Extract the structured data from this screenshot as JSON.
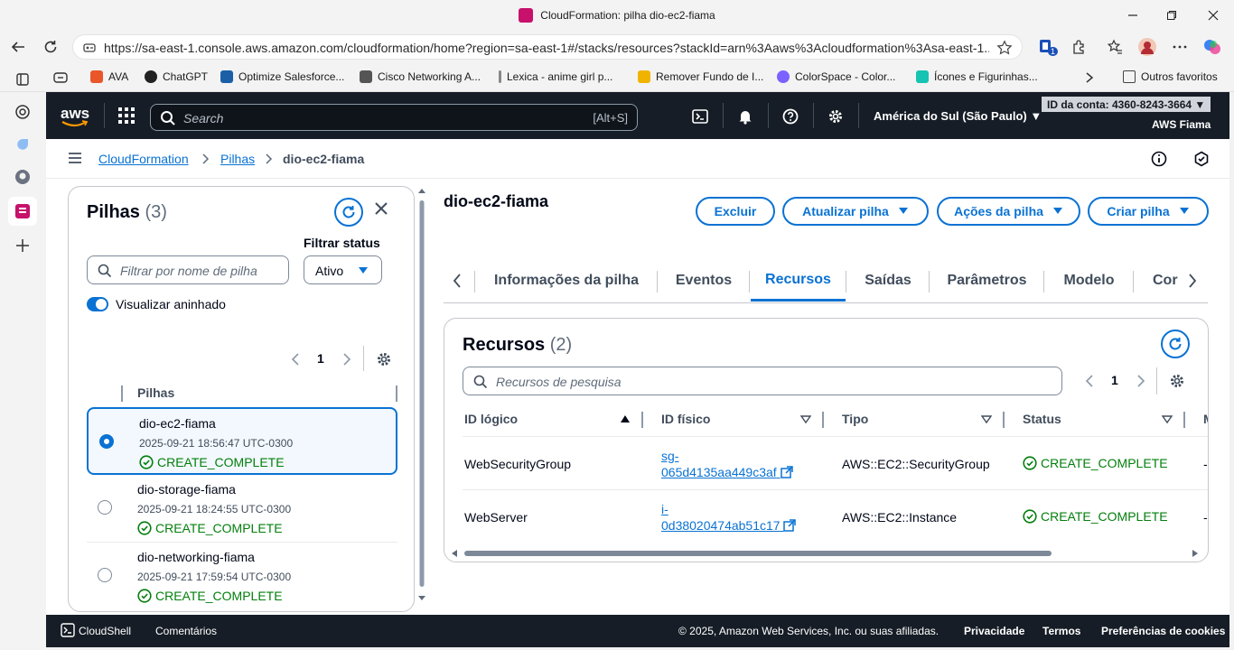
{
  "browser": {
    "tab_title": "CloudFormation: pilha dio-ec2-fiama",
    "url": "https://sa-east-1.console.aws.amazon.com/cloudformation/home?region=sa-east-1#/stacks/resources?stackId=arn%3Aaws%3Acloudformation%3Asa-east-1...",
    "extension_badge": "1",
    "bookmarks": [
      {
        "label": "AVA",
        "icon": "ava-icon",
        "color": "#e8562a"
      },
      {
        "label": "ChatGPT",
        "icon": "chatgpt-icon",
        "color": "#222222"
      },
      {
        "label": "Optimize Salesforce...",
        "icon": "salesforce-icon",
        "color": "#1b5fa8"
      },
      {
        "label": "Cisco Networking A...",
        "icon": "cisco-icon",
        "color": "#555555"
      },
      {
        "label": "Lexica - anime girl p...",
        "icon": "lexica-icon",
        "color": "#888888"
      },
      {
        "label": "Remover Fundo de I...",
        "icon": "remove-bg-icon",
        "color": "#f0b400"
      },
      {
        "label": "ColorSpace - Color...",
        "icon": "colorspace-icon",
        "color": "#7b61ff"
      },
      {
        "label": "Ícones e Figurinhas...",
        "icon": "icons-icon",
        "color": "#17c3b2"
      }
    ],
    "other_favorites": "Outros favoritos"
  },
  "aws": {
    "logo": "aws",
    "search_placeholder": "Search",
    "search_shortcut": "[Alt+S]",
    "region": "América do Sul (São Paulo)",
    "account": "ID da conta: 4360-8243-3664",
    "user": "AWS Fiama"
  },
  "breadcrumb": {
    "root": "CloudFormation",
    "stacks": "Pilhas",
    "current": "dio-ec2-fiama"
  },
  "stacks_panel": {
    "title": "Pilhas",
    "count": "(3)",
    "filter_label": "Filtrar status",
    "filter_placeholder": "Filtrar por nome de pilha",
    "status_value": "Ativo",
    "nested_toggle_label": "Visualizar aninhado",
    "page": "1",
    "column": "Pilhas",
    "stacks": [
      {
        "name": "dio-ec2-fiama",
        "date": "2025-09-21 18:56:47 UTC-0300",
        "status": "CREATE_COMPLETE",
        "selected": true
      },
      {
        "name": "dio-storage-fiama",
        "date": "2025-09-21 18:24:55 UTC-0300",
        "status": "CREATE_COMPLETE",
        "selected": false
      },
      {
        "name": "dio-networking-fiama",
        "date": "2025-09-21 17:59:54 UTC-0300",
        "status": "CREATE_COMPLETE",
        "selected": false
      }
    ]
  },
  "main": {
    "title": "dio-ec2-fiama",
    "buttons": {
      "delete": "Excluir",
      "update": "Atualizar pilha",
      "actions": "Ações da pilha",
      "create": "Criar pilha"
    },
    "tabs": [
      "Informações da pilha",
      "Eventos",
      "Recursos",
      "Saídas",
      "Parâmetros",
      "Modelo",
      "Cor"
    ],
    "active_tab": "Recursos"
  },
  "resources": {
    "title": "Recursos",
    "count": "(2)",
    "search_placeholder": "Recursos de pesquisa",
    "page": "1",
    "columns": {
      "logical": "ID lógico",
      "physical": "ID físico",
      "type": "Tipo",
      "status": "Status",
      "extra": "M"
    },
    "rows": [
      {
        "logical": "WebSecurityGroup",
        "physical_1": "sg-",
        "physical_2": "065d4135aa449c3af",
        "type": "AWS::EC2::SecurityGroup",
        "status": "CREATE_COMPLETE",
        "extra": "-"
      },
      {
        "logical": "WebServer",
        "physical_1": "i-",
        "physical_2": "0d38020474ab51c17",
        "type": "AWS::EC2::Instance",
        "status": "CREATE_COMPLETE",
        "extra": "-"
      }
    ]
  },
  "footer": {
    "cloudshell": "CloudShell",
    "comments": "Comentários",
    "copyright": "© 2025, Amazon Web Services, Inc. ou suas afiliadas.",
    "privacy": "Privacidade",
    "terms": "Termos",
    "cookies": "Preferências de cookies"
  },
  "colors": {
    "accent": "#0972d3",
    "success": "#037f0c",
    "nav_bg": "#161d26"
  }
}
